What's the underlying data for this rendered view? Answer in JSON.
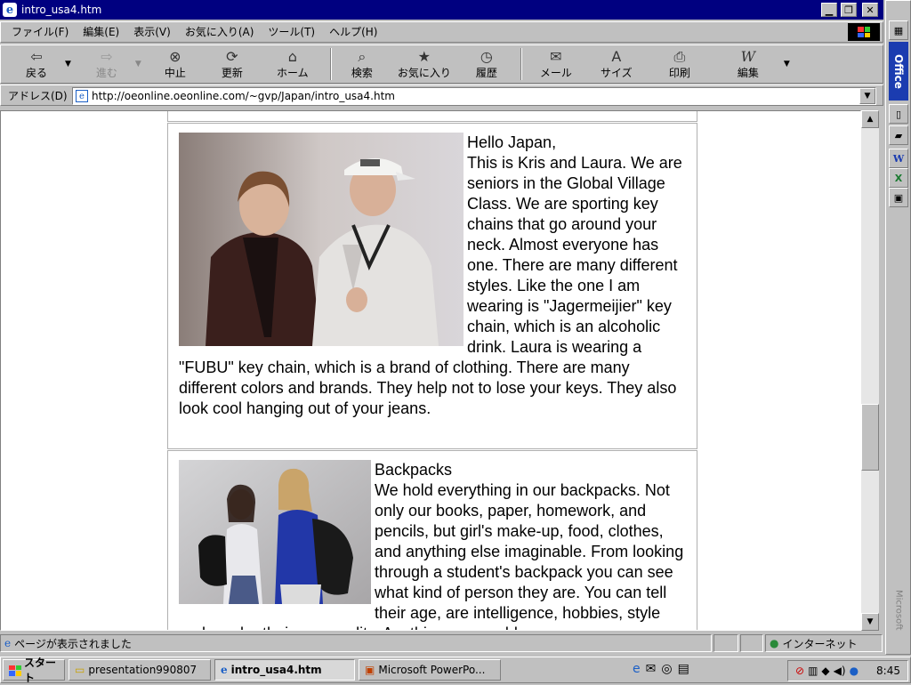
{
  "window": {
    "title": "intro_usa4.htm"
  },
  "menu": [
    "ファイル(F)",
    "編集(E)",
    "表示(V)",
    "お気に入り(A)",
    "ツール(T)",
    "ヘルプ(H)"
  ],
  "toolbar": {
    "back": "戻る",
    "forward": "進む",
    "stop": "中止",
    "refresh": "更新",
    "home": "ホーム",
    "search": "検索",
    "favorites": "お気に入り",
    "history": "履歴",
    "mail": "メール",
    "size": "サイズ",
    "print": "印刷",
    "edit": "編集"
  },
  "address": {
    "label": "アドレス(D)",
    "url": "http://oeonline.oeonline.com/~gvp/Japan/intro_usa4.htm"
  },
  "content": {
    "card1": {
      "greeting": "Hello Japan,",
      "body": "This is Kris and Laura. We are seniors in the Global Village Class. We are sporting key chains that go around your neck. Almost everyone has one. There are many different styles. Like the one I am wearing is \"Jagermeijier\" key chain, which is an alcoholic drink. Laura is wearing a \"FUBU\" key chain, which is a brand of clothing. There are many different colors and brands. They help not to lose your keys. They also look cool hanging out of your jeans."
    },
    "card2": {
      "heading": "Backpacks",
      "body": "We hold everything in our backpacks. Not only our books, paper, homework, and pencils, but girl's make-up, food, clothes, and anything else imaginable. From looking through a student's backpack you can see what kind of person they are. You can tell their age, are intelligence, hobbies, style and maybe their personality. Anything you could ever"
    }
  },
  "status": {
    "text": "ページが表示されました",
    "zone": "インターネット"
  },
  "taskbar": {
    "start": "スタート",
    "tasks": [
      "presentation990807",
      "intro_usa4.htm",
      "Microsoft PowerPo..."
    ],
    "clock": "8:45"
  },
  "office": {
    "label": "Office",
    "vendor": "Microsoft"
  }
}
